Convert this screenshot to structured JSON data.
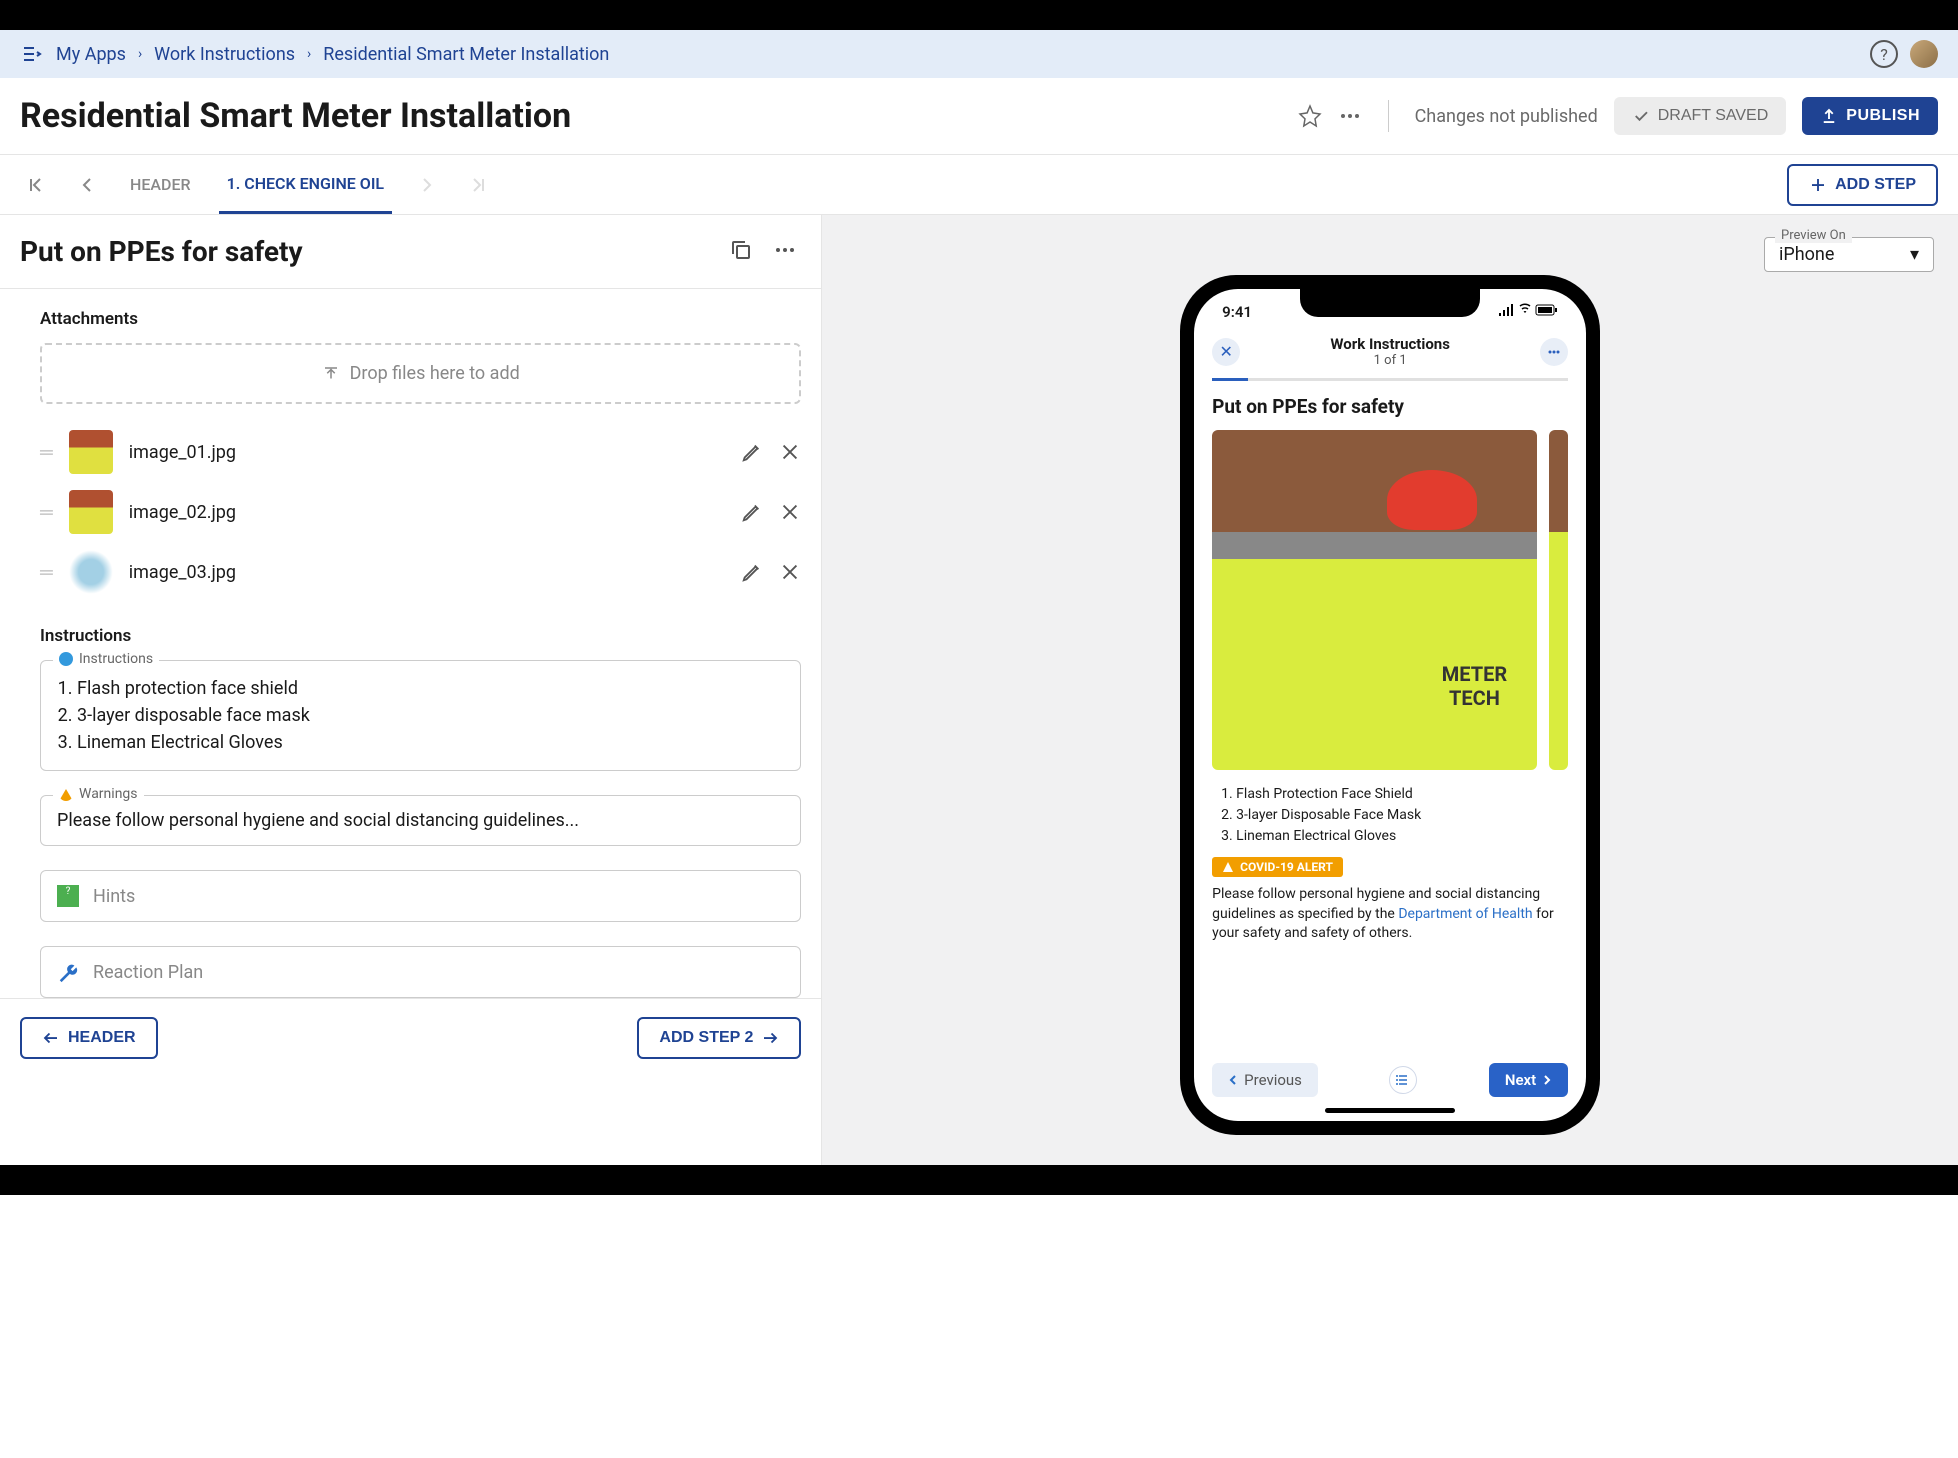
{
  "breadcrumb": {
    "items": [
      "My Apps",
      "Work Instructions",
      "Residential Smart Meter Installation"
    ]
  },
  "page": {
    "title": "Residential Smart Meter Installation",
    "status": "Changes not published",
    "draft_btn": "DRAFT SAVED",
    "publish_btn": "PUBLISH"
  },
  "tabs": {
    "header": "HEADER",
    "step1": "1. CHECK ENGINE OIL",
    "add_step": "ADD STEP"
  },
  "step": {
    "title": "Put on PPEs for safety"
  },
  "attachments": {
    "label": "Attachments",
    "dropzone": "Drop files here to add",
    "items": [
      {
        "name": "image_01.jpg"
      },
      {
        "name": "image_02.jpg"
      },
      {
        "name": "image_03.jpg"
      }
    ]
  },
  "instructions": {
    "section_label": "Instructions",
    "field_label": "Instructions",
    "items": [
      "Flash protection face shield",
      "3-layer disposable face mask",
      "Lineman Electrical Gloves"
    ]
  },
  "warnings": {
    "field_label": "Warnings",
    "text": "Please follow personal hygiene and social distancing guidelines..."
  },
  "hints": {
    "placeholder": "Hints"
  },
  "reaction": {
    "placeholder": "Reaction Plan"
  },
  "bottom_nav": {
    "prev": "HEADER",
    "next": "ADD STEP 2"
  },
  "preview": {
    "label": "Preview On",
    "value": "iPhone"
  },
  "phone": {
    "time": "9:41",
    "header_title": "Work Instructions",
    "header_sub": "1 of 1",
    "step_title": "Put on PPEs for safety",
    "img_text1": "METER",
    "img_text2": "TECH",
    "list": [
      "Flash Protection Face Shield",
      "3-layer Disposable Face Mask",
      "Lineman Electrical Gloves"
    ],
    "covid_badge": "COVID-19 ALERT",
    "guideline_1": "Please follow personal hygiene and social distancing guidelines as specified by the ",
    "guideline_link": "Department of Health",
    "guideline_2": " for your safety and safety of others.",
    "prev_btn": "Previous",
    "next_btn": "Next"
  }
}
